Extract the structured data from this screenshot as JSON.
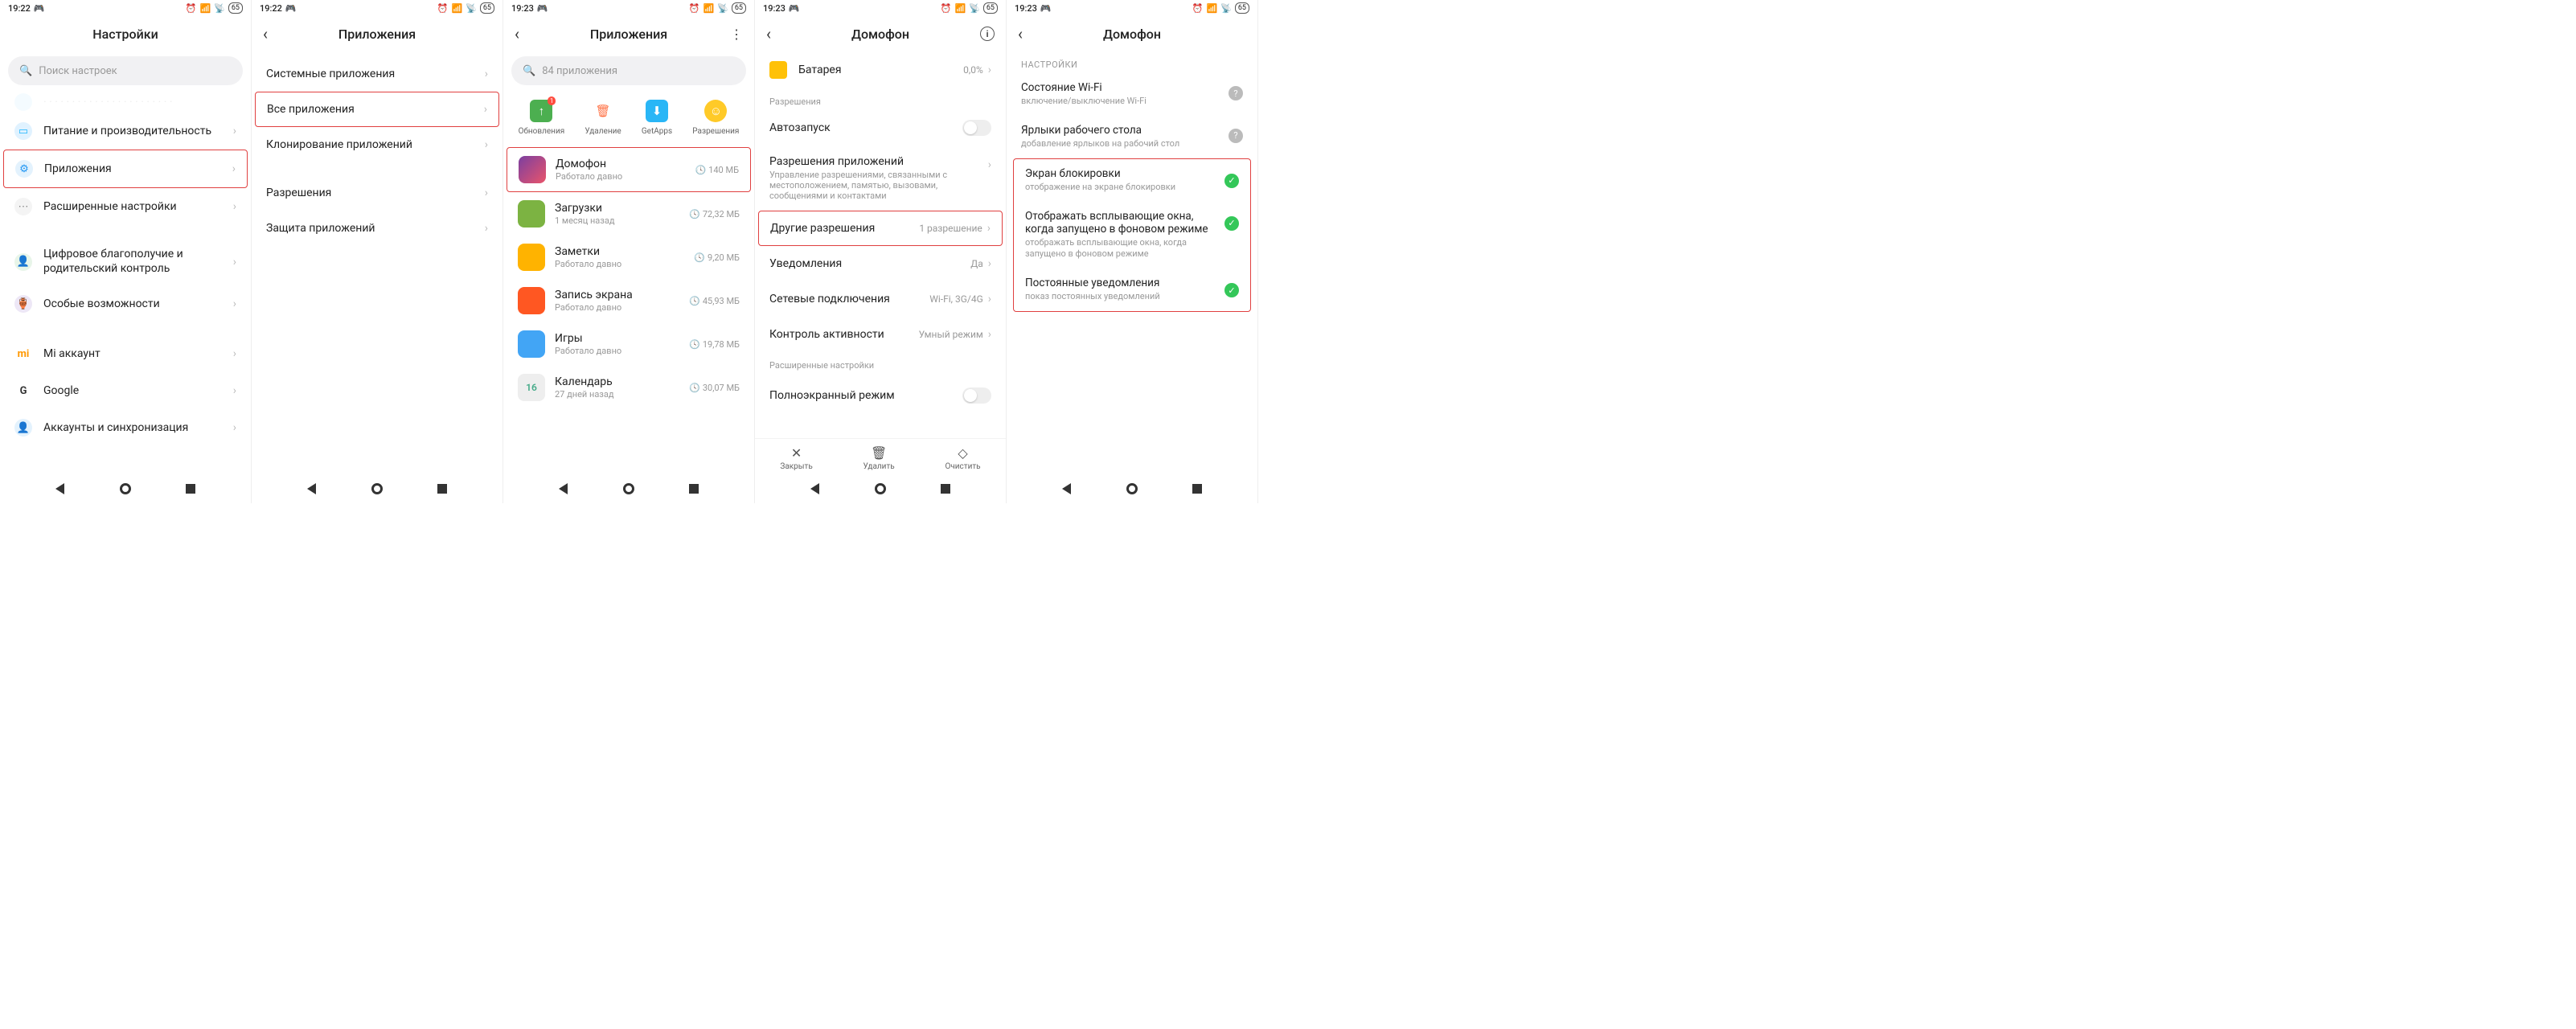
{
  "status": {
    "time1": "19:22",
    "time2": "19:23",
    "battery": "65"
  },
  "s1": {
    "title": "Настройки",
    "search_placeholder": "Поиск настроек",
    "partial_row": "",
    "items": [
      {
        "label": "Питание и производительность",
        "icon_color": "#1fb6ff"
      },
      {
        "label": "Приложения",
        "icon_color": "#2196f3"
      },
      {
        "label": "Расширенные настройки",
        "icon_color": "#9e9e9e"
      },
      {
        "label": "Цифровое благополучие и родительский контроль",
        "icon_color": "#4caf50"
      },
      {
        "label": "Особые возможности",
        "icon_color": "#673ab7"
      },
      {
        "label": "Mi аккаунт",
        "icon_color": "#ff9800"
      },
      {
        "label": "Google",
        "icon_color": "#ffffff"
      },
      {
        "label": "Аккаунты и синхронизация",
        "icon_color": "#2196f3"
      }
    ]
  },
  "s2": {
    "title": "Приложения",
    "items": [
      "Системные приложения",
      "Все приложения",
      "Клонирование приложений",
      "Разрешения",
      "Защита приложений"
    ]
  },
  "s3": {
    "title": "Приложения",
    "search_placeholder": "84 приложения",
    "actions": [
      {
        "label": "Обновления",
        "badge": "1",
        "color": "#4caf50",
        "glyph": "↑"
      },
      {
        "label": "Удаление",
        "color": "#ff7043",
        "glyph": "🗑"
      },
      {
        "label": "GetApps",
        "color": "#29b6f6",
        "glyph": "G"
      },
      {
        "label": "Разрешения",
        "color": "#ffca28",
        "glyph": "☺"
      }
    ],
    "apps": [
      {
        "name": "Домофон",
        "sub": "Работало давно",
        "size": "140 МБ",
        "bg": "linear-gradient(135deg,#7b3fa0,#e9546b)"
      },
      {
        "name": "Загрузки",
        "sub": "1 месяц назад",
        "size": "72,32 МБ",
        "bg": "#7cb342"
      },
      {
        "name": "Заметки",
        "sub": "Работало давно",
        "size": "9,20 МБ",
        "bg": "#ffb300"
      },
      {
        "name": "Запись экрана",
        "sub": "Работало давно",
        "size": "45,93 МБ",
        "bg": "#ff5722"
      },
      {
        "name": "Игры",
        "sub": "Работало давно",
        "size": "19,78 МБ",
        "bg": "#42a5f5"
      },
      {
        "name": "Календарь",
        "sub": "27 дней назад",
        "size": "30,07 МБ",
        "bg": "#eeeeee"
      }
    ]
  },
  "s4": {
    "title": "Домофон",
    "battery_row": {
      "label": "Батарея",
      "value": "0,0%"
    },
    "section_perms": "Разрешения",
    "rows": [
      {
        "label": "Автозапуск",
        "type": "toggle"
      },
      {
        "label": "Разрешения приложений",
        "sub": "Управление разрешениями, связанными с местоположением, памятью, вызовами, сообщениями и контактами",
        "type": "chevron"
      },
      {
        "label": "Другие разрешения",
        "value": "1 разрешение",
        "type": "chevron"
      },
      {
        "label": "Уведомления",
        "value": "Да",
        "type": "chevron"
      },
      {
        "label": "Сетевые подключения",
        "value": "Wi-Fi, 3G/4G",
        "type": "chevron"
      },
      {
        "label": "Контроль активности",
        "value": "Умный режим",
        "type": "chevron"
      }
    ],
    "section_adv": "Расширенные настройки",
    "fullscreen": "Полноэкранный режим",
    "bottom": [
      "Закрыть",
      "Удалить",
      "Очистить"
    ]
  },
  "s5": {
    "title": "Домофон",
    "section": "НАСТРОЙКИ",
    "rows": [
      {
        "title": "Состояние Wi-Fi",
        "sub": "включение/выключение Wi-Fi",
        "state": "q"
      },
      {
        "title": "Ярлыки рабочего стола",
        "sub": "добавление ярлыков на рабочий стол",
        "state": "q"
      },
      {
        "title": "Экран блокировки",
        "sub": "отображение на экране блокировки",
        "state": "on"
      },
      {
        "title": "Отображать всплывающие окна, когда запущено в фоновом режиме",
        "sub": "отображать всплывающие окна, когда запущено в фоновом режиме",
        "state": "on"
      },
      {
        "title": "Постоянные уведомления",
        "sub": "показ постоянных уведомлений",
        "state": "on"
      }
    ]
  }
}
